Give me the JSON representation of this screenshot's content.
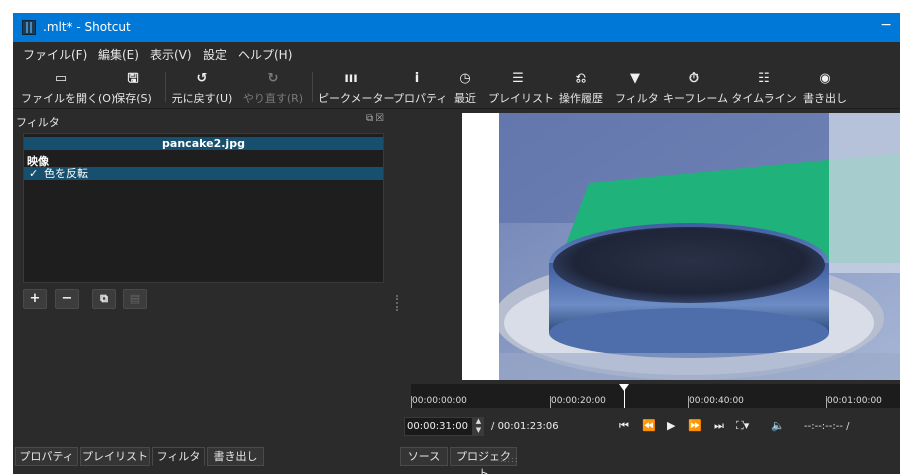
{
  "window": {
    "title": ".mlt* - Shotcut",
    "minimize_glyph": "−"
  },
  "menu": [
    "ファイル(F)",
    "編集(E)",
    "表示(V)",
    "設定",
    "ヘルプ(H)"
  ],
  "toolbar": [
    {
      "icon": "folder-open-icon",
      "glyph": "▭",
      "label": "ファイルを開く(O)"
    },
    {
      "icon": "save-icon",
      "glyph": "🖫",
      "label": "保存(S)"
    },
    {
      "icon": "undo-icon",
      "glyph": "↺",
      "label": "元に戻す(U)"
    },
    {
      "icon": "redo-icon",
      "glyph": "↻",
      "label": "やり直す(R)",
      "disabled": true
    },
    {
      "icon": "peak-meter-icon",
      "glyph": "ııı",
      "label": "ピークメーター"
    },
    {
      "icon": "info-icon",
      "glyph": "i",
      "label": "プロパティ"
    },
    {
      "icon": "clock-icon",
      "glyph": "◷",
      "label": "最近"
    },
    {
      "icon": "list-icon",
      "glyph": "☰",
      "label": "プレイリスト"
    },
    {
      "icon": "history-icon",
      "glyph": "⎌",
      "label": "操作履歴"
    },
    {
      "icon": "filter-icon",
      "glyph": "▼",
      "label": "フィルタ"
    },
    {
      "icon": "stopwatch-icon",
      "glyph": "⏱",
      "label": "キーフレーム"
    },
    {
      "icon": "timeline-icon",
      "glyph": "☷",
      "label": "タイムライン"
    },
    {
      "icon": "export-icon",
      "glyph": "◉",
      "label": "書き出し"
    }
  ],
  "filters_panel": {
    "title": "フィルタ",
    "file_name": "pancake2.jpg",
    "category": "映像",
    "items": [
      {
        "checked": true,
        "check_glyph": "✓",
        "name": "色を反転"
      }
    ],
    "buttons": [
      {
        "name": "add-filter-button",
        "glyph": "+"
      },
      {
        "name": "remove-filter-button",
        "glyph": "−"
      },
      {
        "name": "copy-filter-button",
        "glyph": "⧉"
      },
      {
        "name": "paste-filter-button",
        "glyph": "▤"
      }
    ],
    "title_buttons": "⧉☒"
  },
  "timeline": {
    "labels": [
      "00:00:00:00",
      "00:00:20:00",
      "00:00:40:00",
      "00:01:00:00"
    ],
    "playhead_time": "00:00:31:00"
  },
  "transport": {
    "current": "00:00:31:00",
    "separator": "/",
    "duration": "00:01:23:06",
    "in_out": "--:--:--:-- /",
    "buttons": [
      {
        "name": "skip-previous-icon",
        "glyph": "⏮"
      },
      {
        "name": "rewind-icon",
        "glyph": "⏪"
      },
      {
        "name": "play-icon",
        "glyph": "▶"
      },
      {
        "name": "fast-forward-icon",
        "glyph": "⏩"
      },
      {
        "name": "skip-next-icon",
        "glyph": "⏭"
      },
      {
        "name": "zoom-fit-icon",
        "glyph": "⛶▾"
      },
      {
        "name": "volume-icon",
        "glyph": "🔈"
      }
    ]
  },
  "bottom_tabs_left": [
    "プロパティ",
    "プレイリスト",
    "フィルタ",
    "書き出し"
  ],
  "bottom_tabs_right": [
    "ソース",
    "プロジェクト"
  ],
  "active_tab": "フィルタ"
}
